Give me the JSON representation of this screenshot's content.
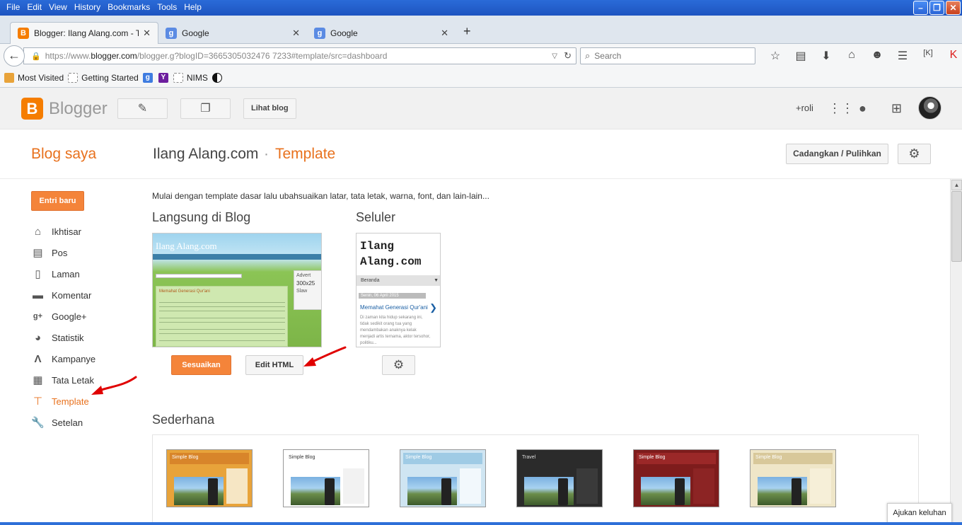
{
  "browser": {
    "menu": [
      "File",
      "Edit",
      "View",
      "History",
      "Bookmarks",
      "Tools",
      "Help"
    ],
    "tabs": [
      {
        "title": "Blogger: Ilang Alang.com - Te...",
        "icon": "blogger-icon"
      },
      {
        "title": "Google",
        "icon": "google-icon"
      },
      {
        "title": "Google",
        "icon": "google-icon"
      }
    ],
    "url_prefix": "https://www.",
    "url_host": "blogger.com",
    "url_rest": "/blogger.g?blogID=3665305032476 7233#template/src=dashboard",
    "search_placeholder": "Search",
    "bookmarks": [
      "Most Visited",
      "Getting Started",
      "NIMS"
    ]
  },
  "header": {
    "logo_letter": "B",
    "logo_text": "Blogger",
    "view_blog": "Lihat blog",
    "user": "+roli"
  },
  "titlebar": {
    "section": "Blog saya",
    "blog_name": "Ilang Alang.com",
    "separator": "·",
    "page": "Template",
    "backup_button": "Cadangkan / Pulihkan"
  },
  "sidebar": {
    "new_post": "Entri baru",
    "items": [
      {
        "label": "Ikhtisar",
        "icon": "home-icon"
      },
      {
        "label": "Pos",
        "icon": "posts-icon"
      },
      {
        "label": "Laman",
        "icon": "pages-icon"
      },
      {
        "label": "Komentar",
        "icon": "comment-icon"
      },
      {
        "label": "Google+",
        "icon": "google-plus-icon"
      },
      {
        "label": "Statistik",
        "icon": "stats-icon"
      },
      {
        "label": "Kampanye",
        "icon": "campaign-icon"
      },
      {
        "label": "Tata Letak",
        "icon": "layout-icon"
      },
      {
        "label": "Template",
        "icon": "template-icon"
      },
      {
        "label": "Setelan",
        "icon": "wrench-icon"
      }
    ]
  },
  "main": {
    "intro": "Mulai dengan template dasar lalu ubahsuaikan latar, tata letak, warna, font, dan lain-lain...",
    "live_heading": "Langsung di Blog",
    "mobile_heading": "Seluler",
    "customize_button": "Sesuaikan",
    "edit_html_button": "Edit HTML",
    "simple_heading": "Sederhana",
    "preview": {
      "title": "Ilang Alang.com",
      "post_title": "Memahat Generasi Qur'ani",
      "side_title": "Advert",
      "side_number": "300x25",
      "side_sub": "Slaw"
    },
    "mobile_preview": {
      "title": "Ilang Alang.com",
      "nav": "Beranda",
      "date": "Senin, 06 April 2015",
      "post": "Memahat Generasi Qur'ani",
      "excerpt": "Di zaman kita hidup sekarang ini, tidak sedikit orang tua yang mendambakan anaknya kelak menjadi artis ternama, aktor tersohor, politiku..."
    },
    "thumbnails": [
      {
        "title": "Simple Blog",
        "bg": "#e8a33a",
        "hd": "#d8852a"
      },
      {
        "title": "Simple Blog",
        "bg": "#ffffff",
        "hd": "#ffffff"
      },
      {
        "title": "Simple Blog",
        "bg": "#cfe5f2",
        "hd": "#9fcbe5"
      },
      {
        "title": "Travel",
        "bg": "#2b2b2b",
        "hd": "#2b2b2b"
      },
      {
        "title": "Simple Blog",
        "bg": "#7e1c1c",
        "hd": "#9b2828"
      },
      {
        "title": "Simple Blog",
        "bg": "#efe6c8",
        "hd": "#d8c89a"
      }
    ]
  },
  "feedback": "Ajukan keluhan",
  "colors": {
    "accent": "#e8711d",
    "orange_button": "#f4843a",
    "annotation_arrow": "#e00000"
  }
}
